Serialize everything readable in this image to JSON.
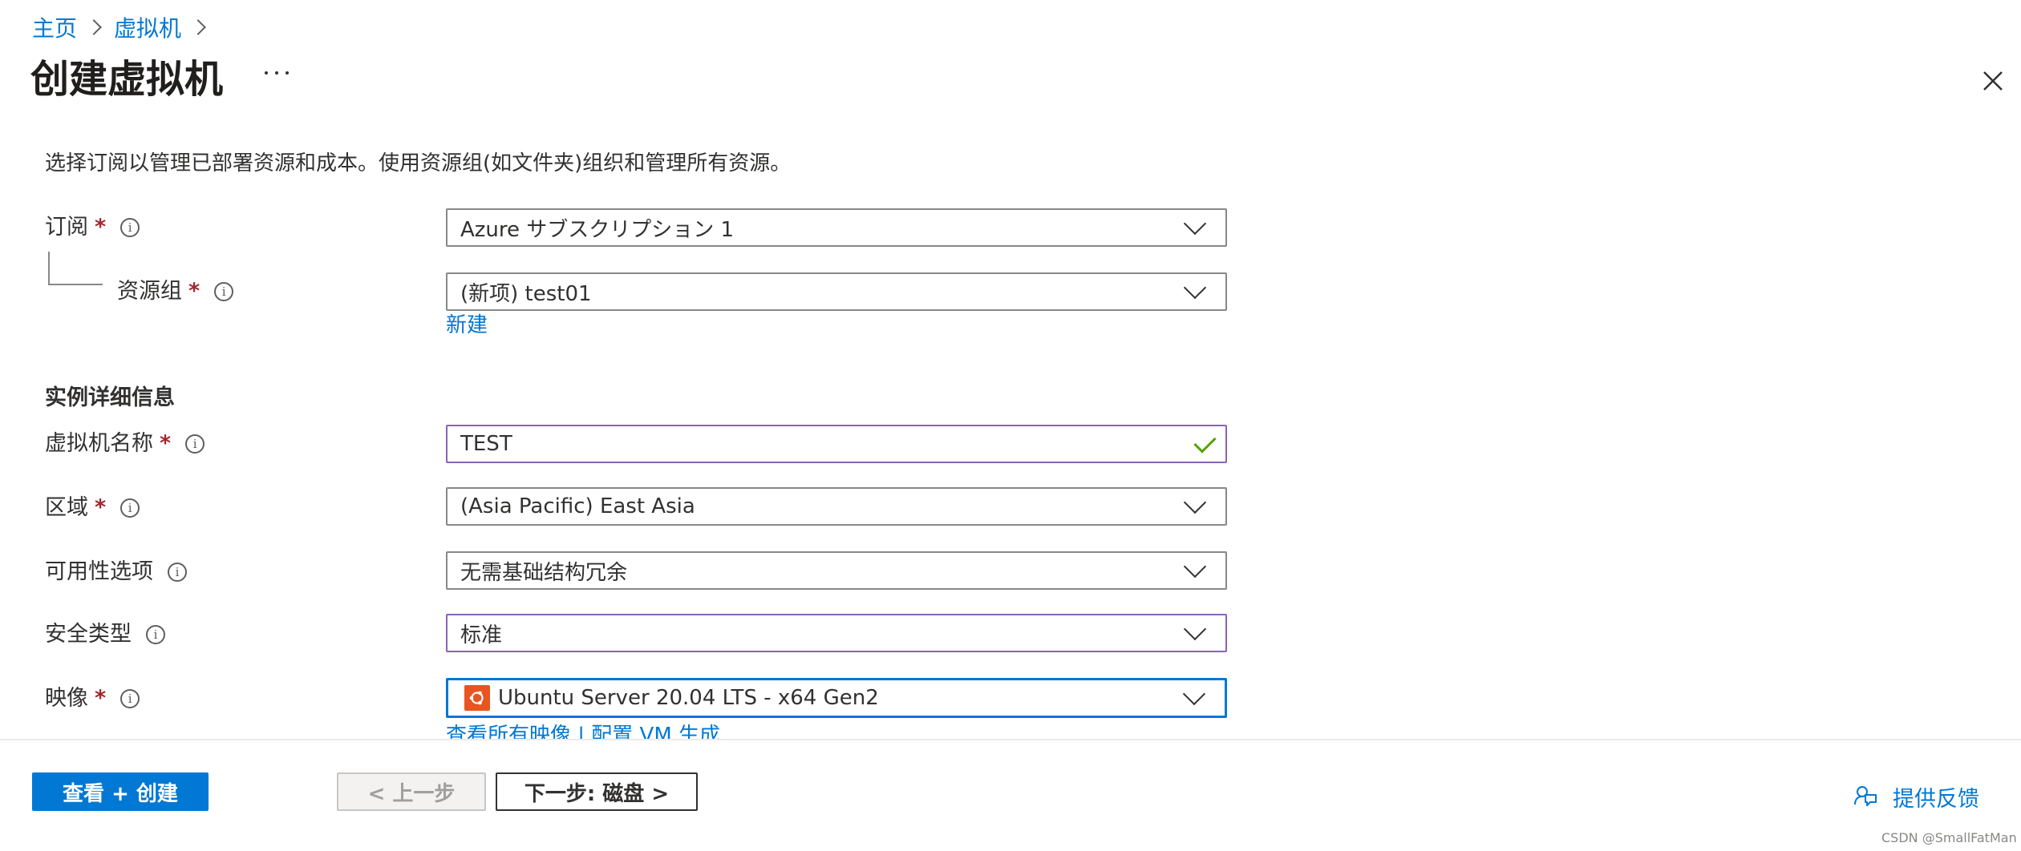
{
  "breadcrumb": {
    "items": [
      "主页",
      "虚拟机"
    ]
  },
  "page": {
    "title": "创建虚拟机",
    "more_icon": "ellipsis-icon",
    "close_icon": "close-icon"
  },
  "description": "选择订阅以管理已部署资源和成本。使用资源组(如文件夹)组织和管理所有资源。",
  "form": {
    "subscription": {
      "label": "订阅",
      "required_mark": "*",
      "value": "Azure サブスクリプション 1"
    },
    "resource_group": {
      "label": "资源组",
      "required_mark": "*",
      "value": "(新项) test01",
      "create_new_link": "新建"
    },
    "instance_section_title": "实例详细信息",
    "vm_name": {
      "label": "虚拟机名称",
      "required_mark": "*",
      "value": "TEST"
    },
    "region": {
      "label": "区域",
      "required_mark": "*",
      "value": "(Asia Pacific) East Asia"
    },
    "availability": {
      "label": "可用性选项",
      "value": "无需基础结构冗余"
    },
    "security_type": {
      "label": "安全类型",
      "value": "标准"
    },
    "image": {
      "label": "映像",
      "required_mark": "*",
      "value": "Ubuntu Server 20.04 LTS - x64 Gen2",
      "links_text": "查看所有映像 | 配置 VM 生成"
    }
  },
  "footer": {
    "review_create": "查看 + 创建",
    "previous": "< 上一步",
    "next": "下一步: 磁盘 >",
    "feedback": "提供反馈"
  },
  "watermark": "CSDN @SmallFatMan",
  "colors": {
    "accent": "#0078d4",
    "required": "#a4262c",
    "valid_check": "#57a300",
    "image_icon": "#e95420",
    "highlight_border": "#8764b8"
  }
}
